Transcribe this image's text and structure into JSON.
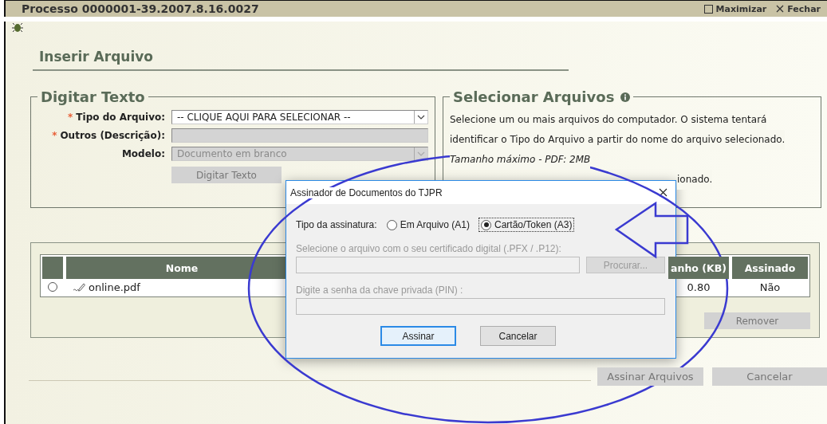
{
  "window": {
    "title": "Processo 0000001-39.2007.8.16.0027",
    "actions": [
      {
        "kind": "maximize",
        "label": "Maximizar"
      },
      {
        "kind": "close",
        "label": "Fechar"
      }
    ]
  },
  "page": {
    "heading": "Inserir Arquivo"
  },
  "digitar_texto": {
    "legend": "Digitar Texto",
    "fields": [
      {
        "kind": "select",
        "marker": "*",
        "label": "Tipo do Arquivo:",
        "value": "-- CLIQUE AQUI PARA SELECIONAR --",
        "disabled": false
      },
      {
        "kind": "input",
        "marker": "*",
        "label": "Outros (Descrição):",
        "disabled": true
      },
      {
        "kind": "select",
        "label": "Modelo:",
        "value": "Documento em branco",
        "disabled": true
      }
    ],
    "button": {
      "label": "Digitar Texto",
      "disabled": true
    }
  },
  "selecionar_arquivos": {
    "legend": "Selecionar Arquivos",
    "lines": [
      {
        "text": "Selecione um ou mais arquivos do computador. O sistema tentará",
        "italic": false
      },
      {
        "text": "identificar o Tipo do Arquivo a partir do nome do arquivo selecionado.",
        "italic": false
      },
      {
        "text": "Tamanho máximo - PDF: 2MB",
        "italic": true
      },
      {
        "text": "ionado.",
        "italic": false
      }
    ]
  },
  "table": {
    "columns": [
      "Nome",
      "anho (KB)",
      "Assinado"
    ],
    "rows": [
      {
        "selected": false,
        "name": "online.pdf",
        "size": "0.80",
        "signed": "Não"
      }
    ],
    "remove_button": {
      "label": "Remover",
      "disabled": true
    }
  },
  "footer": {
    "buttons": [
      {
        "label": "Assinar Arquivos",
        "disabled": true
      },
      {
        "label": "Cancelar",
        "disabled": true
      }
    ]
  },
  "dialog": {
    "title": "Assinador de Documentos do TJPR",
    "type_label": "Tipo da assinatura:",
    "options": [
      {
        "label": "Em Arquivo (A1)",
        "selected": false
      },
      {
        "label": "Cartão/Token (A3)",
        "selected": true
      }
    ],
    "cert_label": "Selecione o arquivo com o seu certificado digital (.PFX / .P12):",
    "cert_disabled": true,
    "browse_button": "Procurar...",
    "pin_label": "Digite a senha da chave privada (PIN) :",
    "buttons": [
      {
        "label": "Assinar",
        "default": true
      },
      {
        "label": "Cancelar",
        "default": false
      }
    ]
  }
}
